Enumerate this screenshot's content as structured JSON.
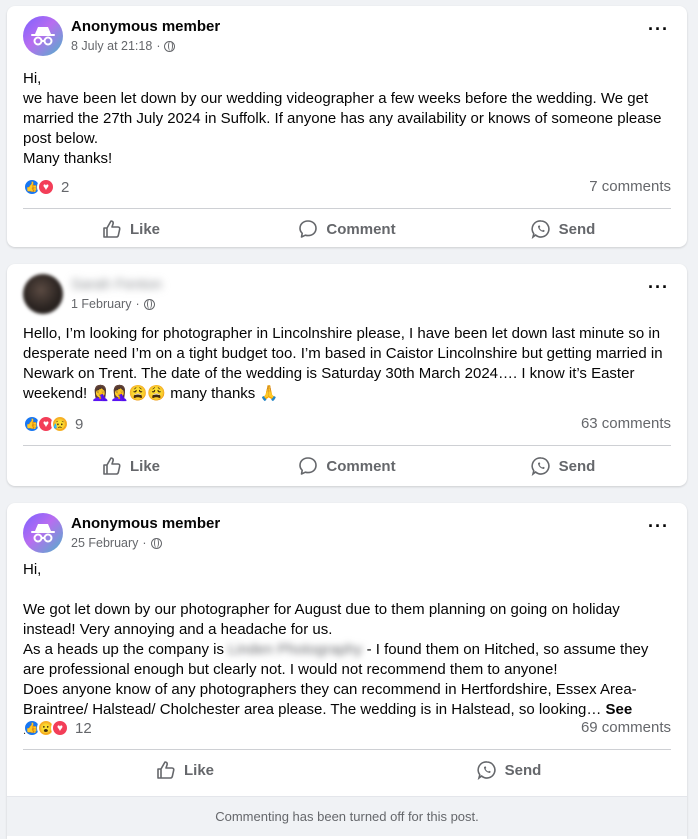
{
  "posts": [
    {
      "author": "Anonymous member",
      "time": "8 July at 21:18",
      "body": "Hi,\nwe have been let down by our wedding videographer a few weeks before the wedding. We get married the 27th July 2024 in Suffolk. If anyone has any availability or knows of someone please post below.\nMany thanks!",
      "reaction_count": "2",
      "comments": "7 comments",
      "actions": {
        "like": "Like",
        "comment": "Comment",
        "send": "Send"
      }
    },
    {
      "author": "Sarah Fenton",
      "time": "1 February",
      "body": "Hello, I’m looking for photographer in Lincolnshire please, I have been let down last minute so in desperate need I’m on a tight budget too. I’m based in Caistor Lincolnshire but getting married in Newark on Trent. The date of the wedding is Saturday 30th March 2024…. I know it’s Easter weekend! 🤦‍♀️🤦‍♀️😩😩 many thanks 🙏",
      "reaction_count": "9",
      "comments": "63 comments",
      "actions": {
        "like": "Like",
        "comment": "Comment",
        "send": "Send"
      }
    },
    {
      "author": "Anonymous member",
      "time": "25 February",
      "body_intro": "Hi,\n\nWe got let down by our photographer for August due to them planning on going on holiday instead! Very annoying and a headache for us.\nAs a heads up the company is ",
      "company": "Linden Photography",
      "body_rest": " - I found them on Hitched, so assume they are professional enough but clearly not. I would not recommend them to anyone!\nDoes anyone know of any photographers they can recommend in Hertfordshire, Essex Area- Braintree/ Halstead/ Cholchester area please. The wedding is in Halstead, so looking… ",
      "see_more": "See more",
      "reaction_count": "12",
      "comments": "69 comments",
      "actions": {
        "like": "Like",
        "send": "Send"
      },
      "commenting_off": "Commenting has been turned off for this post."
    }
  ],
  "icons": {
    "anon": "anonymous-member-icon",
    "privacy": "globe-icon",
    "more": "more-options-icon",
    "like": "thumbs-up-icon",
    "comment": "comment-bubble-icon",
    "send": "whatsapp-send-icon"
  },
  "colors": {
    "like": "#1877f2",
    "love": "#f33e58",
    "haha": "#f7b125",
    "muted": "#65676b"
  }
}
